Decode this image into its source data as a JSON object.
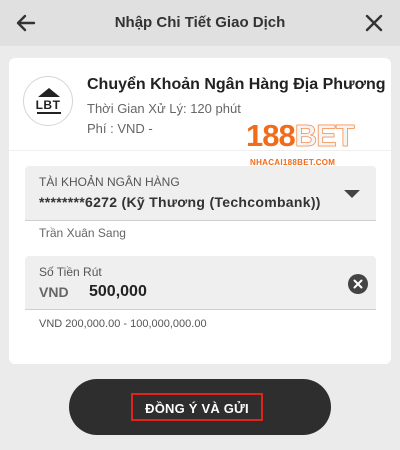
{
  "header": {
    "title": "Nhập Chi Tiết Giao Dịch",
    "back_icon": "arrow-left-icon",
    "close_icon": "close-icon"
  },
  "method": {
    "logo_text": "LBT",
    "name": "Chuyển Khoản Ngân Hàng Địa Phương",
    "processing_time": "Thời Gian Xử Lý: 120 phút",
    "fee": "Phí : VND -"
  },
  "watermark": {
    "brand_prefix": "188",
    "brand_suffix": "BET",
    "domain": "NHACAI188BET.COM",
    "brand_color": "#f26b1a"
  },
  "bank_account": {
    "label": "TÀI KHOẢN NGÂN HÀNG",
    "value": "********6272 (Kỹ Thương (Techcombank))",
    "holder": "Trần Xuân Sang"
  },
  "amount": {
    "label": "Số Tiền Rút",
    "currency": "VND",
    "value": "500,000",
    "range": "VND 200,000.00 - 100,000,000.00"
  },
  "submit": {
    "label": "ĐỒNG Ý VÀ GỬI",
    "highlight_color": "#e0231b"
  }
}
